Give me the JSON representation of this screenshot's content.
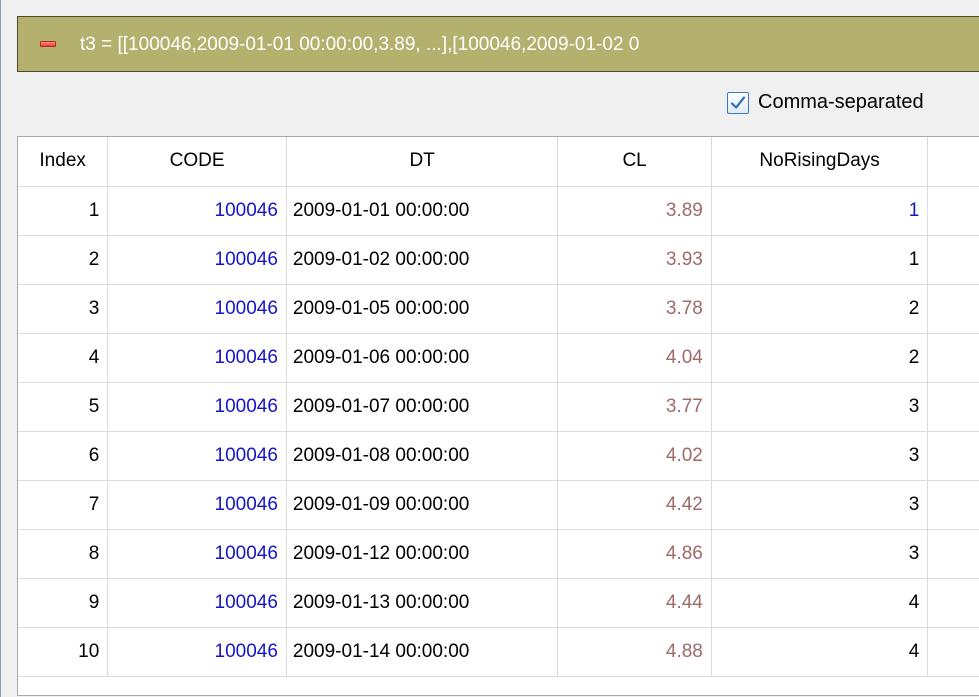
{
  "title_bar": {
    "text": "t3 = [[100046,2009-01-01 00:00:00,3.89, ...],[100046,2009-01-02 0"
  },
  "options": {
    "comma_separated_label": "Comma-separated",
    "comma_separated_checked": true
  },
  "table": {
    "columns": [
      "Index",
      "CODE",
      "DT",
      "CL",
      "NoRisingDays"
    ],
    "rows": [
      {
        "index": "1",
        "code": "100046",
        "dt": "2009-01-01 00:00:00",
        "cl": "3.89",
        "no_rising_days": "1"
      },
      {
        "index": "2",
        "code": "100046",
        "dt": "2009-01-02 00:00:00",
        "cl": "3.93",
        "no_rising_days": "1"
      },
      {
        "index": "3",
        "code": "100046",
        "dt": "2009-01-05 00:00:00",
        "cl": "3.78",
        "no_rising_days": "2"
      },
      {
        "index": "4",
        "code": "100046",
        "dt": "2009-01-06 00:00:00",
        "cl": "4.04",
        "no_rising_days": "2"
      },
      {
        "index": "5",
        "code": "100046",
        "dt": "2009-01-07 00:00:00",
        "cl": "3.77",
        "no_rising_days": "3"
      },
      {
        "index": "6",
        "code": "100046",
        "dt": "2009-01-08 00:00:00",
        "cl": "4.02",
        "no_rising_days": "3"
      },
      {
        "index": "7",
        "code": "100046",
        "dt": "2009-01-09 00:00:00",
        "cl": "4.42",
        "no_rising_days": "3"
      },
      {
        "index": "8",
        "code": "100046",
        "dt": "2009-01-12 00:00:00",
        "cl": "4.86",
        "no_rising_days": "3"
      },
      {
        "index": "9",
        "code": "100046",
        "dt": "2009-01-13 00:00:00",
        "cl": "4.44",
        "no_rising_days": "4"
      },
      {
        "index": "10",
        "code": "100046",
        "dt": "2009-01-14 00:00:00",
        "cl": "4.88",
        "no_rising_days": "4"
      }
    ]
  },
  "colors": {
    "title_bar_bg": "#b4b06e",
    "code_text": "#1414c8",
    "cl_text": "#9e6a6a",
    "checkbox_accent": "#3b7bbf"
  },
  "icons": {
    "collapse": "minus-collapse-icon",
    "check": "checkmark-icon"
  }
}
